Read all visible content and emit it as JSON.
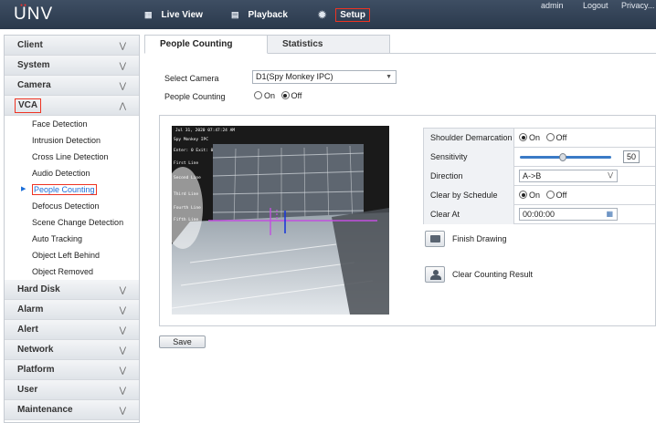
{
  "brand": {
    "logo": "UNV",
    "accent": "#e8312f"
  },
  "nav": {
    "live_view": "Live View",
    "playback": "Playback",
    "setup": "Setup",
    "admin": "admin",
    "logout": "Logout",
    "privacy": "Privacy..."
  },
  "sidebar": {
    "client": "Client",
    "system": "System",
    "camera": "Camera",
    "vca": "VCA",
    "vca_items": [
      "Face Detection",
      "Intrusion Detection",
      "Cross Line Detection",
      "Audio Detection",
      "People Counting",
      "Defocus Detection",
      "Scene Change Detection",
      "Auto Tracking",
      "Object Left Behind",
      "Object Removed"
    ],
    "hard_disk": "Hard Disk",
    "alarm": "Alarm",
    "alert": "Alert",
    "network": "Network",
    "platform": "Platform",
    "user": "User",
    "maintenance": "Maintenance"
  },
  "tabs": {
    "people_counting": "People Counting",
    "statistics": "Statistics"
  },
  "form": {
    "select_camera_label": "Select Camera",
    "select_camera_value": "D1(Spy Monkey IPC)",
    "people_counting_label": "People Counting",
    "on": "On",
    "off": "Off"
  },
  "video": {
    "timestamp": "Jul 31, 2020 07:47:24 AM",
    "camera_name": "Spy Monkey IPC",
    "counts": "Enter: 0 Exit: 0",
    "lines": [
      "First Line",
      "Second Line",
      "Third Line",
      "Fourth Line",
      "Fifth Line"
    ]
  },
  "settings": {
    "shoulder_label": "Shoulder Demarcation",
    "sensitivity_label": "Sensitivity",
    "sensitivity_value": "50",
    "direction_label": "Direction",
    "direction_value": "A->B",
    "clear_schedule_label": "Clear by Schedule",
    "clear_at_label": "Clear At",
    "clear_at_value": "00:00:00"
  },
  "actions": {
    "finish_drawing": "Finish Drawing",
    "clear_counting": "Clear Counting Result",
    "save": "Save"
  }
}
